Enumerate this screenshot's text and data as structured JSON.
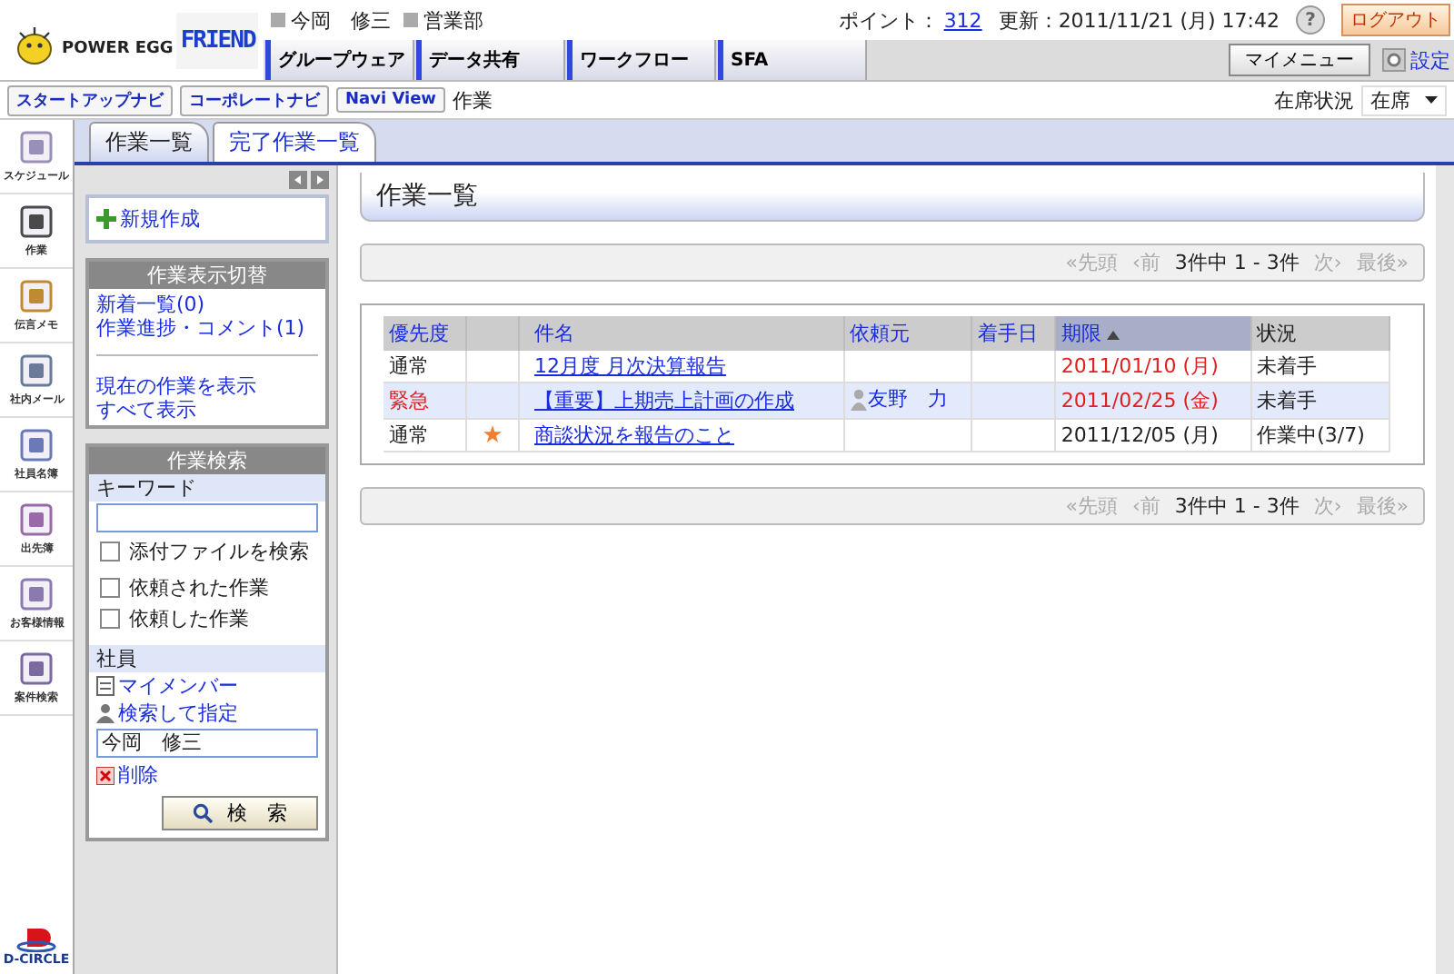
{
  "header": {
    "brand": "POWER EGG",
    "product": "FRIEND",
    "user_name": "今岡　修三",
    "department": "営業部",
    "points_label": "ポイント：",
    "points": "312",
    "updated": "更新：2011/11/21 (月) 17:42",
    "help": "?",
    "logout": "ログアウト"
  },
  "nav_tabs": [
    {
      "label": "グループウェア"
    },
    {
      "label": "データ共有"
    },
    {
      "label": "ワークフロー"
    },
    {
      "label": "SFA"
    }
  ],
  "my_menu": "マイメニュー",
  "settings": "設定",
  "breadcrumbs": [
    "スタートアップナビ",
    "コーポレートナビ",
    "Navi View"
  ],
  "page": "作業",
  "presence": {
    "label": "在席状況",
    "value": "在席"
  },
  "app_sidebar": [
    {
      "label": "スケジュール"
    },
    {
      "label": "作業"
    },
    {
      "label": "伝言メモ"
    },
    {
      "label": "社内メール"
    },
    {
      "label": "社員名簿"
    },
    {
      "label": "出先簿"
    },
    {
      "label": "お客様情報"
    },
    {
      "label": "案件検索"
    }
  ],
  "company_logo": "D-CIRCLE",
  "view_tabs": [
    {
      "label": "作業一覧",
      "selected": true
    },
    {
      "label": "完了作業一覧",
      "selected": false
    }
  ],
  "left_panel": {
    "new_button": "新規作成",
    "display_switch": {
      "title": "作業表示切替",
      "links": [
        "新着一覧(0)",
        "作業進捗・コメント(1)"
      ],
      "links2": [
        "現在の作業を表示",
        "すべて表示"
      ]
    },
    "search": {
      "title": "作業検索",
      "keyword_label": "キーワード",
      "attachment": {
        "label": "添付ファイルを検索",
        "checked": false
      },
      "requests": [
        {
          "label": "依頼された作業",
          "checked": false
        },
        {
          "label": "依頼した作業",
          "checked": false
        }
      ],
      "employee_label": "社員",
      "my_members": "マイメンバー",
      "search_specify": "検索して指定",
      "employee_value": "今岡　修三",
      "delete": "削除",
      "search_button": "検　索"
    }
  },
  "main": {
    "title": "作業一覧",
    "pager_top": {
      "first": "«先頭",
      "prev": "‹前",
      "summary": "3件中 1 - 3件",
      "next": "次›",
      "last": "最後»",
      "disabled": true
    },
    "table": {
      "columns": [
        {
          "kind": "priority",
          "label": "優先度",
          "sortable": true,
          "sorted": false
        },
        {
          "kind": "flag"
        },
        {
          "kind": "link",
          "label": "件名",
          "sortable": true,
          "sorted": false
        },
        {
          "kind": "person",
          "label": "依頼元",
          "sortable": true,
          "sorted": false
        },
        {
          "kind": "date",
          "label": "着手日",
          "sortable": true,
          "sorted": false
        },
        {
          "kind": "deadline",
          "label": "期限",
          "sortable": true,
          "sorted": true
        },
        {
          "kind": "text",
          "label": "状況",
          "sortable": false,
          "sorted": false
        }
      ],
      "rows": [
        {
          "priority": "通常",
          "urgent": false,
          "starred": false,
          "title": "12月度 月次決算報告",
          "deadline": "2011/01/10 (月)",
          "overdue": true,
          "status": "未着手",
          "selected": false
        },
        {
          "priority": "緊急",
          "urgent": true,
          "starred": false,
          "title": "【重要】上期売上計画の作成",
          "requester": "友野　力",
          "deadline": "2011/02/25 (金)",
          "overdue": true,
          "status": "未着手",
          "selected": true
        },
        {
          "priority": "通常",
          "urgent": false,
          "starred": true,
          "title": "商談状況を報告のこと",
          "deadline": "2011/12/05 (月)",
          "overdue": false,
          "status": "作業中(3/7)",
          "selected": false
        }
      ]
    },
    "pager_bottom": {
      "first": "«先頭",
      "prev": "‹前",
      "summary": "3件中 1 - 3件",
      "next": "次›",
      "last": "最後»",
      "disabled": true
    }
  }
}
